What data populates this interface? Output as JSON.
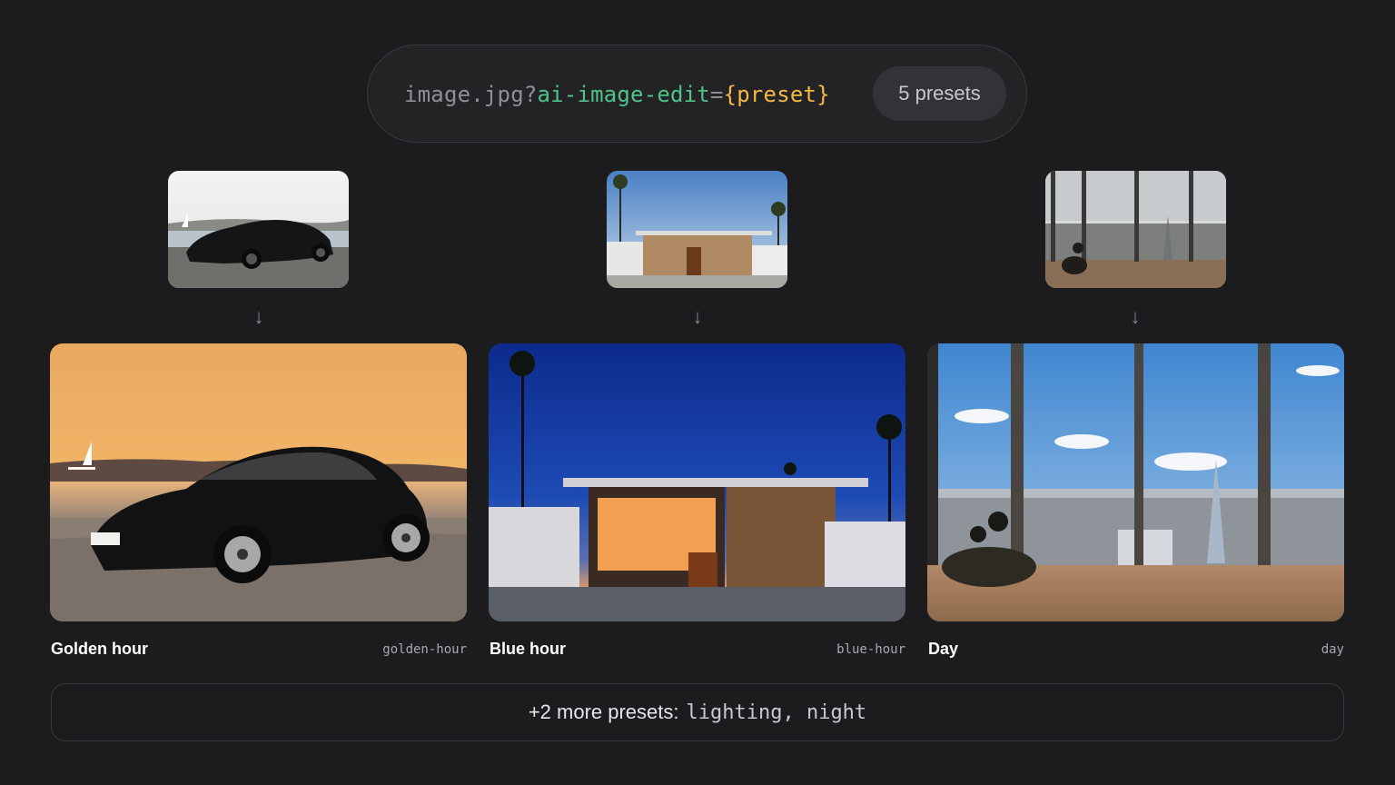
{
  "url": {
    "base": "image.jpg?",
    "param": "ai-image-edit",
    "eq": "=",
    "value": "{preset}",
    "preset_count": "5 presets"
  },
  "arrow_glyph": "↓",
  "presets": [
    {
      "title": "Golden hour",
      "slug": "golden-hour"
    },
    {
      "title": "Blue hour",
      "slug": "blue-hour"
    },
    {
      "title": "Day",
      "slug": "day"
    }
  ],
  "more": {
    "label": "+2 more presets:",
    "list": "lighting, night"
  },
  "colors": {
    "background": "#1c1c1f",
    "param": "#4fc38a",
    "value": "#f4b942"
  }
}
